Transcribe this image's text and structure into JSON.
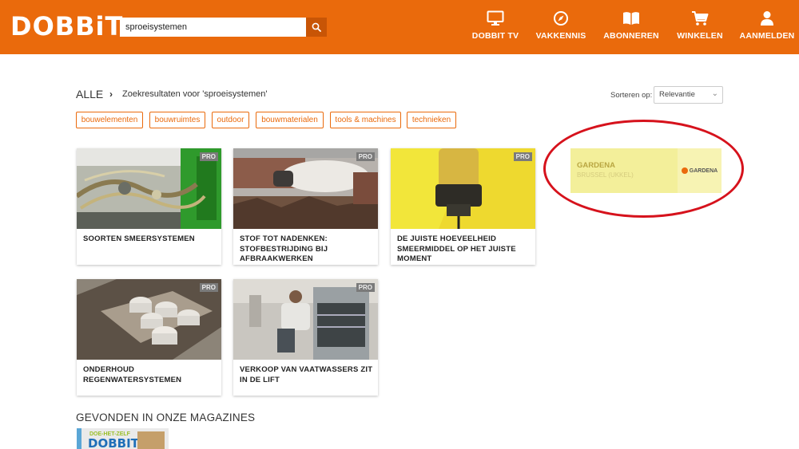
{
  "header": {
    "logo": "DOBBiT",
    "search": {
      "value": "sproeisystemen",
      "placeholder": ""
    },
    "nav": [
      {
        "label": "DOBBIT TV",
        "icon": "tv-icon"
      },
      {
        "label": "VAKKENNIS",
        "icon": "compass-icon"
      },
      {
        "label": "ABONNEREN",
        "icon": "book-icon"
      },
      {
        "label": "WINKELEN",
        "icon": "cart-icon"
      },
      {
        "label": "AANMELDEN",
        "icon": "user-icon"
      }
    ],
    "colors": {
      "brand": "#ea6a0c",
      "brand_dark": "#c85506"
    }
  },
  "breadcrumb": {
    "root": "ALLE",
    "separator": "›",
    "current": "Zoekresultaten voor 'sproeisystemen'"
  },
  "sort": {
    "label": "Sorteren op:",
    "value": "Relevantie"
  },
  "filters": [
    "bouwelementen",
    "bouwruimtes",
    "outdoor",
    "bouwmaterialen",
    "tools & machines",
    "technieken"
  ],
  "results": [
    {
      "title": "SOORTEN SMEERSYSTEMEN",
      "badge": "PRO"
    },
    {
      "title": "STOF TOT NADENKEN: STOFBESTRIJDING BIJ AFBRAAKWERKEN",
      "badge": "PRO"
    },
    {
      "title": "DE JUISTE HOEVEELHEID SMEERMIDDEL OP HET JUISTE MOMENT",
      "badge": "PRO"
    },
    {
      "title": "ONDERHOUD REGENWATERSYSTEMEN",
      "badge": "PRO"
    },
    {
      "title": "VERKOOP VAN VAATWASSERS ZIT IN DE LIFT",
      "badge": "PRO"
    }
  ],
  "ad": {
    "brand": "GARDENA",
    "location": "BRUSSEL (UKKEL)",
    "logo": "GARDENA"
  },
  "magazines": {
    "heading": "GEVONDEN IN ONZE MAGAZINES",
    "cover_text": "DOE-HET-ZELF",
    "cover_logo": "DOBBIT"
  }
}
